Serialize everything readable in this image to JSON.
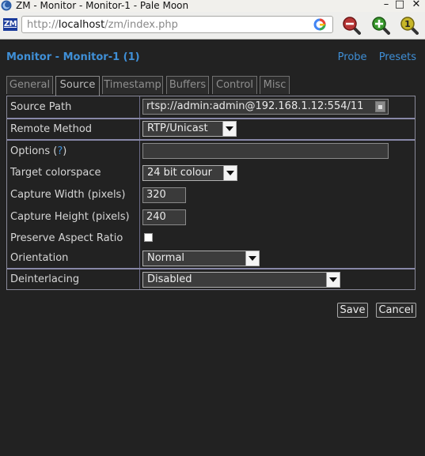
{
  "window": {
    "title": "ZM - Monitor - Monitor-1 - Pale Moon",
    "controls": {
      "minimize": "–",
      "maximize": "□",
      "close": "✕"
    }
  },
  "toolbar": {
    "favicon_text": "ZM",
    "url_prefix": "http://",
    "url_host": "localhost",
    "url_path": "/zm/index.php",
    "icons": [
      "google-search-icon",
      "zoom-out-icon",
      "zoom-in-icon",
      "notification-icon"
    ],
    "notification_count": "1"
  },
  "page": {
    "title": "Monitor - Monitor-1 (1)",
    "links": {
      "probe": "Probe",
      "presets": "Presets"
    },
    "accent_color": "#3f8fd6"
  },
  "tabs": [
    "General",
    "Source",
    "Timestamp",
    "Buffers",
    "Control",
    "Misc"
  ],
  "active_tab": "Source",
  "form": {
    "source_path": {
      "label": "Source Path",
      "value": "rtsp://admin:admin@192.168.1.12:554/11"
    },
    "remote_method": {
      "label": "Remote Method",
      "value": "RTP/Unicast"
    },
    "options": {
      "label": "Options (",
      "help": "?",
      "label_end": ")",
      "value": ""
    },
    "target_colorspace": {
      "label": "Target colorspace",
      "value": "24 bit colour"
    },
    "capture_width": {
      "label": "Capture Width (pixels)",
      "value": "320"
    },
    "capture_height": {
      "label": "Capture Height (pixels)",
      "value": "240"
    },
    "preserve_aspect": {
      "label": "Preserve Aspect Ratio",
      "checked": false
    },
    "orientation": {
      "label": "Orientation",
      "value": "Normal"
    },
    "deinterlacing": {
      "label": "Deinterlacing",
      "value": "Disabled"
    }
  },
  "buttons": {
    "save": "Save",
    "cancel": "Cancel"
  }
}
